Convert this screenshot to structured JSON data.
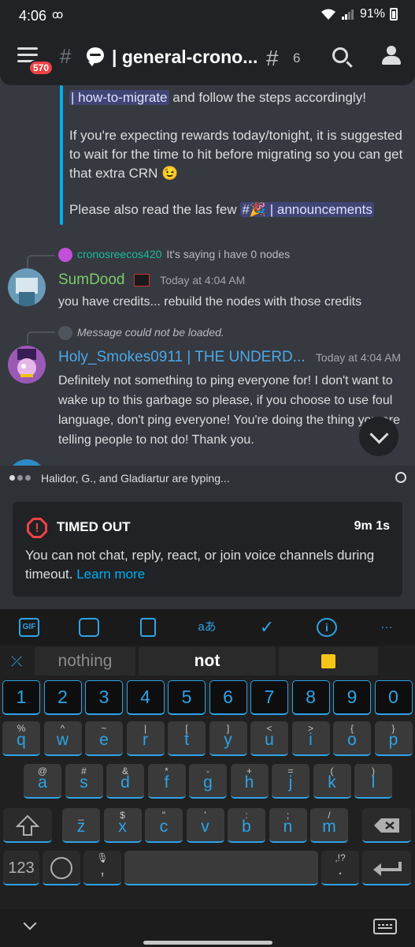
{
  "status_bar": {
    "time": "4:06",
    "voicemail": "ꝏ",
    "battery": "91%"
  },
  "header": {
    "notification_badge": "570",
    "hash": "#",
    "channel_name": "| general-crono...",
    "thread_icon": "#",
    "thread_count": "6"
  },
  "chat": {
    "embed": {
      "line1_mention": "| how-to-migrate",
      "line1_rest": " and follow the steps accordingly!",
      "para2": "If you're expecting rewards today/tonight, it is suggested to wait for the time to hit before migrating so you can get that extra CRN",
      "para2_emoji": "😉",
      "para3_prefix": "Please also read the las few ",
      "para3_mention_hash": "#",
      "para3_mention_emoji": "🎉",
      "para3_mention": " | announcements"
    },
    "messages": [
      {
        "reply_name": "cronosreecos420",
        "reply_text": "It's saying i have 0 nodes",
        "author": "SumDood",
        "author_color": "#7fc96b",
        "timestamp": "Today at 4:04 AM",
        "text": "you have credits... rebuild the nodes with those credits"
      },
      {
        "reply_text": "Message could not be loaded.",
        "author": "Holy_Smokes0911 | THE UNDERD...",
        "author_color": "#4aa8e8",
        "timestamp": "Today at 4:04 AM",
        "text": "Definitely not something to ping everyone for! I don't want to wake up to this garbage so please, if you choose to use foul language, don't ping everyone! You're doing the thing you are telling people to not do! Thank you."
      }
    ]
  },
  "typing": {
    "text": "Halidor, G., and Gladiartur are typing..."
  },
  "timeout": {
    "title": "TIMED OUT",
    "remaining": "9m 1s",
    "body": "You can not chat, reply, react, or join voice channels during timeout.",
    "link": "Learn more"
  },
  "keyboard": {
    "toolbar": {
      "gif": "GIF",
      "translate": "aあ",
      "more": "···"
    },
    "suggestions": [
      "nothing",
      "not"
    ],
    "number_row": [
      "1",
      "2",
      "3",
      "4",
      "5",
      "6",
      "7",
      "8",
      "9",
      "0"
    ],
    "row1": [
      {
        "main": "q",
        "alt": "%"
      },
      {
        "main": "w",
        "alt": "^"
      },
      {
        "main": "e",
        "alt": "~"
      },
      {
        "main": "r",
        "alt": "|"
      },
      {
        "main": "t",
        "alt": "["
      },
      {
        "main": "y",
        "alt": "]"
      },
      {
        "main": "u",
        "alt": "<"
      },
      {
        "main": "i",
        "alt": ">"
      },
      {
        "main": "o",
        "alt": "{"
      },
      {
        "main": "p",
        "alt": "}"
      }
    ],
    "row2": [
      {
        "main": "a",
        "alt": "@"
      },
      {
        "main": "s",
        "alt": "#"
      },
      {
        "main": "d",
        "alt": "&"
      },
      {
        "main": "f",
        "alt": "*"
      },
      {
        "main": "g",
        "alt": "-"
      },
      {
        "main": "h",
        "alt": "+"
      },
      {
        "main": "j",
        "alt": "="
      },
      {
        "main": "k",
        "alt": "("
      },
      {
        "main": "l",
        "alt": ")"
      }
    ],
    "row3": [
      {
        "main": "z",
        "alt": "_"
      },
      {
        "main": "x",
        "alt": "$"
      },
      {
        "main": "c",
        "alt": "\""
      },
      {
        "main": "v",
        "alt": "'"
      },
      {
        "main": "b",
        "alt": ":"
      },
      {
        "main": "n",
        "alt": ";"
      },
      {
        "main": "m",
        "alt": "/"
      }
    ],
    "sym_key": "123",
    "comma_key": ",",
    "period_key": ".",
    "period_alt": ",!?",
    "accent_color": "#2ea3e6"
  }
}
